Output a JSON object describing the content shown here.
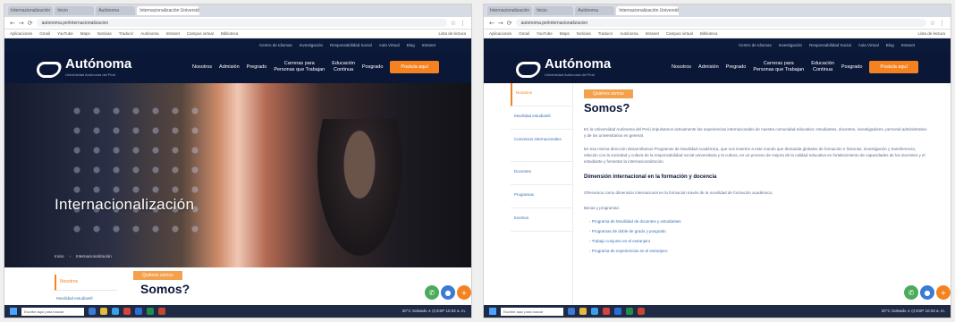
{
  "left": {
    "tabs": [
      "Internacionalización",
      "Inicio",
      "Autónoma",
      "Internacionalización Universidad ×"
    ],
    "url": "autonoma.pe/internacionalizacion",
    "bookmarks": [
      "Aplicaciones",
      "Gmail",
      "YouTube",
      "Maps",
      "Noticias",
      "Traducir",
      "Autónoma",
      "Intranet",
      "Campus virtual",
      "Biblioteca"
    ],
    "extra_bookmark": "Lista de lectura",
    "toplinks": [
      "Centro de Idiomas",
      "Investigación",
      "Responsabilidad Social",
      "Aula Virtual",
      "Blog",
      "Intranet"
    ],
    "logo": {
      "name": "Autónoma",
      "sub": "Universidad Autónoma del Perú"
    },
    "nav": [
      "Nosotros",
      "Admisión",
      "Pregrado",
      "Carreras para\nPersonas que Trabajan",
      "Educación\nContinua",
      "Posgrado"
    ],
    "cta": "Postula aquí",
    "hero_title": "Internacionalización",
    "breadcrumb": [
      "Inicio",
      "›",
      "Internacionalización"
    ],
    "side_active": "Nosotros",
    "side_next": "Movilidad estudiantil",
    "somos_tag": "Quiénes somos",
    "somos_title": "Somos?",
    "taskbar_search": "Escribe aquí para buscar",
    "tray": "20°C  Soleado  ∧  ⊡  ESP  10:32 a. m."
  },
  "right": {
    "tabs": [
      "Internacionalización",
      "Inicio",
      "Autónoma",
      "Internacionalización Universidad ×"
    ],
    "url": "autonoma.pe/internacionalizacion",
    "bookmarks": [
      "Aplicaciones",
      "Gmail",
      "YouTube",
      "Maps",
      "Noticias",
      "Traducir",
      "Autónoma",
      "Intranet",
      "Campus virtual",
      "Biblioteca"
    ],
    "extra_bookmark": "Lista de lectura",
    "toplinks": [
      "Centro de Idiomas",
      "Investigación",
      "Responsabilidad Social",
      "Aula Virtual",
      "Blog",
      "Intranet"
    ],
    "logo": {
      "name": "Autónoma",
      "sub": "Universidad Autónoma del Perú"
    },
    "nav": [
      "Nosotros",
      "Admisión",
      "Pregrado",
      "Carreras para\nPersonas que Trabajan",
      "Educación\nContinua",
      "Posgrado"
    ],
    "cta": "Postula aquí",
    "sidebar": [
      "Nosotros",
      "Movilidad estudiantil",
      "Convenios internacionales",
      "Docentes",
      "Programas",
      "Eventos"
    ],
    "tag": "Quiénes somos",
    "title": "Somos?",
    "p1": "En la Universidad Autónoma del Perú impulsamos activamente las experiencias internacionales de nuestra comunidad educativa: estudiantes, docentes, investigadores, personal administrativo y de los universitarios en general.",
    "p2": "En esa misma dirección desarrollamos Programas de Movilidad Académica, que nos inserten a este mundo que demanda globales de formación e historias, investigación y transferencia, relación con la sociedad y cultura de la responsabilidad social universitaria y la cultura, en un proceso de mejora de la calidad educativa en fortalecimiento de capacidades de los docentes y el estudiante y fomentar la internacionalización.",
    "h3": "Dimensión internacional en la formación y docencia",
    "p3": "Ofrecemos como dimensión internacional en la formación través de la movilidad de formación académica.",
    "list_intro": "Becas y programas:",
    "list": [
      "Programa de Movilidad de docentes y estudiantes",
      "Programas de doble de grado y posgrado",
      "Trabajo conjunto en el extranjero",
      "Programa de experiencias en el extranjero"
    ],
    "taskbar_search": "Escribe aquí para buscar",
    "tray": "20°C  Soleado  ∧  ⊡  ESP  10:33 a. m."
  },
  "colors": {
    "navy": "#0b1736",
    "orange": "#f58220",
    "tag": "#f5a04a",
    "link": "#3a6fb3",
    "whatsapp": "#4cab5b",
    "chat": "#3b7bd6"
  },
  "icons": {
    "fab1": "whatsapp-icon",
    "fab2": "chat-icon",
    "fab3": "plus-icon"
  }
}
